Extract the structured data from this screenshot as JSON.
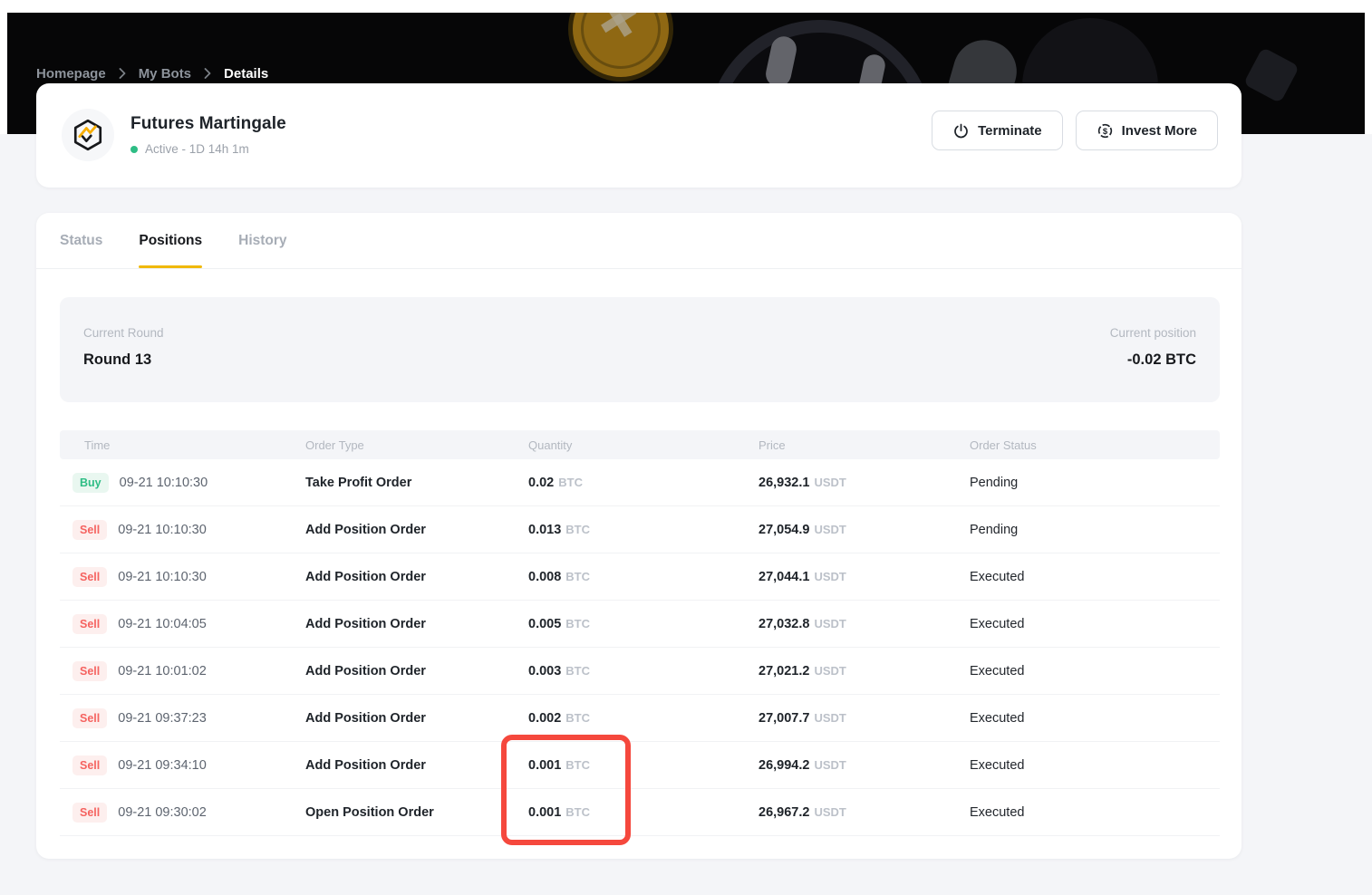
{
  "breadcrumb": {
    "items": [
      {
        "label": "Homepage"
      },
      {
        "label": "My Bots"
      },
      {
        "label": "Details"
      }
    ]
  },
  "header": {
    "title": "Futures Martingale",
    "status": "Active - 1D 14h 1m",
    "terminate_label": "Terminate",
    "invest_label": "Invest More"
  },
  "tabs": [
    {
      "label": "Status"
    },
    {
      "label": "Positions"
    },
    {
      "label": "History"
    }
  ],
  "summary": {
    "round_label": "Current Round",
    "round_value": "Round 13",
    "position_label": "Current position",
    "position_value": "-0.02 BTC"
  },
  "table": {
    "columns": [
      "Time",
      "Order Type",
      "Quantity",
      "Price",
      "Order Status"
    ],
    "rows": [
      {
        "side": "Buy",
        "time": "09-21 10:10:30",
        "order_type": "Take Profit Order",
        "quantity": "0.02",
        "unit": "BTC",
        "price": "26,932.1",
        "price_unit": "USDT",
        "status": "Pending"
      },
      {
        "side": "Sell",
        "time": "09-21 10:10:30",
        "order_type": "Add Position Order",
        "quantity": "0.013",
        "unit": "BTC",
        "price": "27,054.9",
        "price_unit": "USDT",
        "status": "Pending"
      },
      {
        "side": "Sell",
        "time": "09-21 10:10:30",
        "order_type": "Add Position Order",
        "quantity": "0.008",
        "unit": "BTC",
        "price": "27,044.1",
        "price_unit": "USDT",
        "status": "Executed"
      },
      {
        "side": "Sell",
        "time": "09-21 10:04:05",
        "order_type": "Add Position Order",
        "quantity": "0.005",
        "unit": "BTC",
        "price": "27,032.8",
        "price_unit": "USDT",
        "status": "Executed"
      },
      {
        "side": "Sell",
        "time": "09-21 10:01:02",
        "order_type": "Add Position Order",
        "quantity": "0.003",
        "unit": "BTC",
        "price": "27,021.2",
        "price_unit": "USDT",
        "status": "Executed"
      },
      {
        "side": "Sell",
        "time": "09-21 09:37:23",
        "order_type": "Add Position Order",
        "quantity": "0.002",
        "unit": "BTC",
        "price": "27,007.7",
        "price_unit": "USDT",
        "status": "Executed"
      },
      {
        "side": "Sell",
        "time": "09-21 09:34:10",
        "order_type": "Add Position Order",
        "quantity": "0.001",
        "unit": "BTC",
        "price": "26,994.2",
        "price_unit": "USDT",
        "status": "Executed"
      },
      {
        "side": "Sell",
        "time": "09-21 09:30:02",
        "order_type": "Open Position Order",
        "quantity": "0.001",
        "unit": "BTC",
        "price": "26,967.2",
        "price_unit": "USDT",
        "status": "Executed"
      }
    ]
  },
  "colors": {
    "accent": "#f0b90b",
    "buy": "#2ebd85",
    "sell": "#f56360",
    "highlight": "#f5483d",
    "status_dot": "#2ebd85"
  }
}
